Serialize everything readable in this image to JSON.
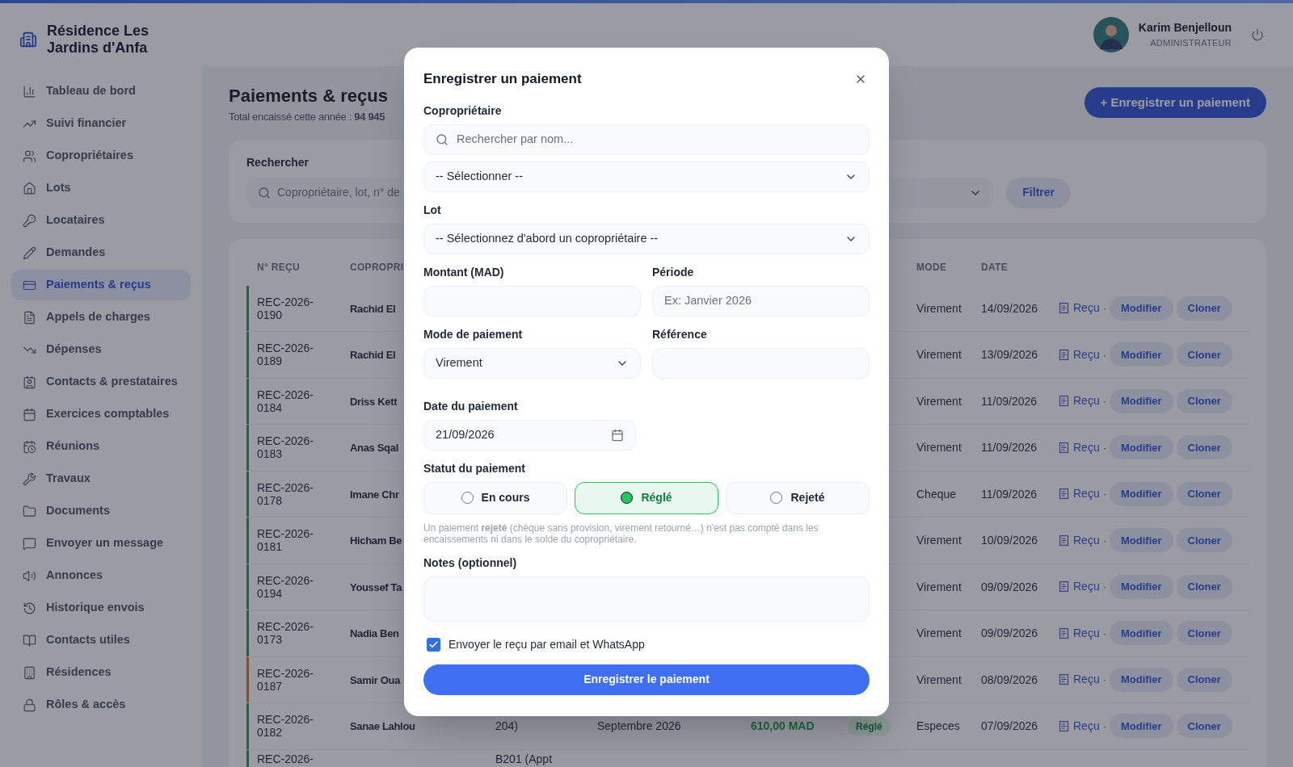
{
  "sidebar": {
    "title": "Résidence Les Jardins d'Anfa",
    "items": [
      {
        "label": "Tableau de bord",
        "selected": false
      },
      {
        "label": "Suivi financier",
        "selected": false
      },
      {
        "label": "Copropriétaires",
        "selected": false
      },
      {
        "label": "Lots",
        "selected": false
      },
      {
        "label": "Locataires",
        "selected": false
      },
      {
        "label": "Demandes",
        "selected": false
      },
      {
        "label": "Paiements & reçus",
        "selected": true
      },
      {
        "label": "Appels de charges",
        "selected": false
      },
      {
        "label": "Dépenses",
        "selected": false
      },
      {
        "label": "Contacts & prestataires",
        "selected": false
      },
      {
        "label": "Exercices comptables",
        "selected": false
      },
      {
        "label": "Réunions",
        "selected": false
      },
      {
        "label": "Travaux",
        "selected": false
      },
      {
        "label": "Documents",
        "selected": false
      },
      {
        "label": "Envoyer un message",
        "selected": false
      },
      {
        "label": "Annonces",
        "selected": false
      },
      {
        "label": "Historique envois",
        "selected": false
      },
      {
        "label": "Contacts utiles",
        "selected": false
      },
      {
        "label": "Résidences",
        "selected": false
      },
      {
        "label": "Rôles & accès",
        "selected": false
      }
    ]
  },
  "user": {
    "name": "Karim Benjelloun",
    "role": "ADMINISTRATEUR"
  },
  "page": {
    "title": "Paiements & reçus",
    "subtitle": "Total encaissé cette année : **94 945**",
    "add_button": "+ Enregistrer un paiement"
  },
  "filters": {
    "search_label": "Rechercher",
    "search_placeholder": "Copropriétaire, lot, n° de",
    "filter_button": "Filtrer"
  },
  "table": {
    "columns": [
      "N° REÇU",
      "COPROPRI",
      "MODE",
      "DATE"
    ],
    "rows": [
      {
        "receipt": "REC-2026-0190",
        "owner": "Rachid El",
        "mode": "Virement",
        "date": "14/09/2026",
        "kind": "settled",
        "actions": {
          "receipt": "Reçu",
          "separator": "·",
          "edit": "Modifier",
          "clone": "Cloner"
        }
      },
      {
        "receipt": "REC-2026-0189",
        "owner": "Rachid El",
        "mode": "Virement",
        "date": "13/09/2026",
        "kind": "settled",
        "actions": {
          "receipt": "Reçu",
          "separator": "·",
          "edit": "Modifier",
          "clone": "Cloner"
        }
      },
      {
        "receipt": "REC-2026-0184",
        "owner": "Driss Kett",
        "mode": "Virement",
        "date": "11/09/2026",
        "kind": "settled",
        "actions": {
          "receipt": "Reçu",
          "separator": "·",
          "edit": "Modifier",
          "clone": "Cloner"
        }
      },
      {
        "receipt": "REC-2026-0183",
        "owner": "Anas Sqal",
        "mode": "Virement",
        "date": "11/09/2026",
        "kind": "settled",
        "actions": {
          "receipt": "Reçu",
          "separator": "·",
          "edit": "Modifier",
          "clone": "Cloner"
        }
      },
      {
        "receipt": "REC-2026-0178",
        "owner": "Imane Chr",
        "mode": "Cheque",
        "date": "11/09/2026",
        "kind": "settled",
        "actions": {
          "receipt": "Reçu",
          "separator": "·",
          "edit": "Modifier",
          "clone": "Cloner"
        }
      },
      {
        "receipt": "REC-2026-0181",
        "owner": "Hicham Be",
        "mode": "Virement",
        "date": "10/09/2026",
        "kind": "settled",
        "actions": {
          "receipt": "Reçu",
          "separator": "·",
          "edit": "Modifier",
          "clone": "Cloner"
        }
      },
      {
        "receipt": "REC-2026-0194",
        "owner": "Youssef Ta",
        "mode": "Virement",
        "date": "09/09/2026",
        "kind": "settled",
        "actions": {
          "receipt": "Reçu",
          "separator": "·",
          "edit": "Modifier",
          "clone": "Cloner"
        }
      },
      {
        "receipt": "REC-2026-0173",
        "owner": "Nadia Ben",
        "mode": "Virement",
        "date": "09/09/2026",
        "kind": "settled",
        "actions": {
          "receipt": "Reçu",
          "separator": "·",
          "edit": "Modifier",
          "clone": "Cloner"
        }
      },
      {
        "receipt": "REC-2026-0187",
        "owner": "Samir Oua",
        "mode": "Virement",
        "date": "08/09/2026",
        "kind": "pending",
        "actions": {
          "receipt": "Reçu",
          "separator": "·",
          "edit": "Modifier",
          "clone": "Cloner"
        }
      },
      {
        "receipt": "REC-2026-0182",
        "owner": "Sanae Lahlou",
        "lot": "204)",
        "period": "Septembre 2026",
        "amount": "610,00 MAD",
        "status": "Réglé",
        "mode": "Especes",
        "date": "07/09/2026",
        "kind": "settled",
        "actions": {
          "receipt": "Reçu",
          "separator": "·",
          "edit": "Modifier",
          "clone": "Cloner"
        }
      },
      {
        "receipt": "REC-2026-",
        "lot": "B201 (Appt",
        "kind": "settled"
      }
    ]
  },
  "modal": {
    "title": "Enregistrer un paiement",
    "owner_label": "Copropriétaire",
    "owner_search_placeholder": "Rechercher par nom...",
    "owner_select": "-- Sélectionner --",
    "lot_label": "Lot",
    "lot_select": "-- Sélectionnez d'abord un copropriétaire --",
    "amount_label": "Montant (MAD)",
    "period_label": "Période",
    "period_placeholder": "Ex: Janvier 2026",
    "mode_label": "Mode de paiement",
    "mode_select": "Virement",
    "reference_label": "Référence",
    "date_label": "Date du paiement",
    "date_value": "21/09/2026",
    "status_label": "Statut du paiement",
    "status_options": [
      {
        "label": "En cours",
        "selected": false
      },
      {
        "label": "Réglé",
        "selected": true
      },
      {
        "label": "Rejeté",
        "selected": false
      }
    ],
    "status_help": "Un paiement **rejeté** (chèque sans provision, virement retourné…) n'est pas compté dans les encaissements ni dans le solde du copropriétaire.",
    "notes_label": "Notes (optionnel)",
    "send_receipt": {
      "label": "Envoyer le reçu par email et WhatsApp",
      "checked": true
    },
    "submit_button": "Enregistrer le paiement"
  }
}
